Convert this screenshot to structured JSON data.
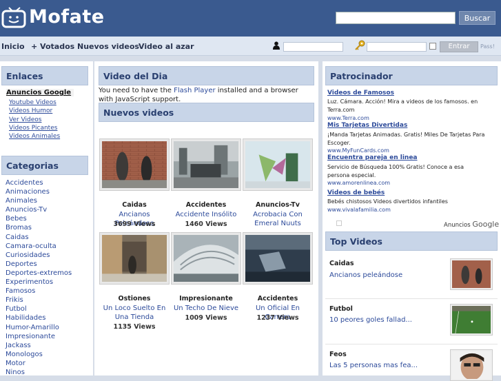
{
  "header": {
    "logo_text": "Mofate",
    "search_placeholder": "",
    "search_button": "Buscar"
  },
  "nav": {
    "items": [
      {
        "label": "Inicio"
      },
      {
        "label": "+ Votados"
      },
      {
        "label": "Nuevos videos"
      },
      {
        "label": "Video al azar"
      }
    ],
    "login_button": "Entrar",
    "forgot_label": "Pass!"
  },
  "left": {
    "links_title": "Enlaces",
    "anuncios_title": "Anuncios Google",
    "ad_links": [
      "Youtube Videos",
      "Videos Humor",
      "Ver Videos",
      "Videos Picantes",
      "Videos Animales"
    ],
    "categories_title": "Categorias",
    "categories": [
      "Accidentes",
      "Animaciones",
      "Animales",
      "Anuncios-Tv",
      "Bebes",
      "Bromas",
      "Caidas",
      "Camara-oculta",
      "Curiosidades",
      "Deportes",
      "Deportes-extremos",
      "Experimentos",
      "Famosos",
      "Frikis",
      "Futbol",
      "Habilidades",
      "Humor-Amarillo",
      "Impresionante",
      "Jackass",
      "Monologos",
      "Motor",
      "Ninos"
    ]
  },
  "middle": {
    "video_del_dia_title": "Video del Dia",
    "flash_msg_pre": "You need to have the ",
    "flash_link": "Flash Player",
    "flash_msg_post": " installed and a browser with JavaScript support.",
    "nuevos_title": "Nuevos videos",
    "videos": [
      {
        "category": "Caidas",
        "title": "Ancianos Peleándose",
        "views": "3699 Views"
      },
      {
        "category": "Accidentes",
        "title": "Accidente Insólito",
        "views": "1460 Views"
      },
      {
        "category": "Anuncios-Tv",
        "title": "Acrobacia Con Emeral Nuuts",
        "views": ""
      },
      {
        "category": "Ostiones",
        "title": "Un Loco Suelto En Una Tienda",
        "views": "1135 Views"
      },
      {
        "category": "Impresionante",
        "title": "Un Techo De Nieve",
        "views": "1009 Views"
      },
      {
        "category": "Accidentes",
        "title": "Un Oficial En Carrera",
        "views": "1237 Views"
      }
    ]
  },
  "right": {
    "sponsor_title": "Patrocinador",
    "sponsors": [
      {
        "title": "Videos de Famosos",
        "desc": "Luz. Cámara. Acción! Mira a videos de los famosos. en Terra.com",
        "url": "www.Terra.com"
      },
      {
        "title": "Mis Tarjetas Divertidas",
        "desc": "¡Manda Tarjetas Animadas. Gratis! Miles De Tarjetas Para Escoger.",
        "url": "www.MyFunCards.com"
      },
      {
        "title": "Encuentra pareja en linea",
        "desc": "Servicio de Búsqueda 100% Gratis! Conoce a esa persona especial.",
        "url": "www.amorenlinea.com"
      },
      {
        "title": "Videos de bebés",
        "desc": "Bebés chistosos Videos divertidos infantiles",
        "url": "www.vivalafamilia.com"
      }
    ],
    "ads_by_label": "Anuncios",
    "ads_by_brand": "Google",
    "top_title": "Top Videos",
    "top_videos": [
      {
        "category": "Caidas",
        "title": "Ancianos peleándose"
      },
      {
        "category": "Futbol",
        "title": "10 peores goles fallad..."
      },
      {
        "category": "Feos",
        "title": "Las 5 personas mas fea..."
      }
    ]
  },
  "colors": {
    "header_bg": "#3a5a8f",
    "nav_bg": "#dfe7f2",
    "panel_head_bg": "#c8d5e8",
    "link": "#2c4a9a"
  }
}
